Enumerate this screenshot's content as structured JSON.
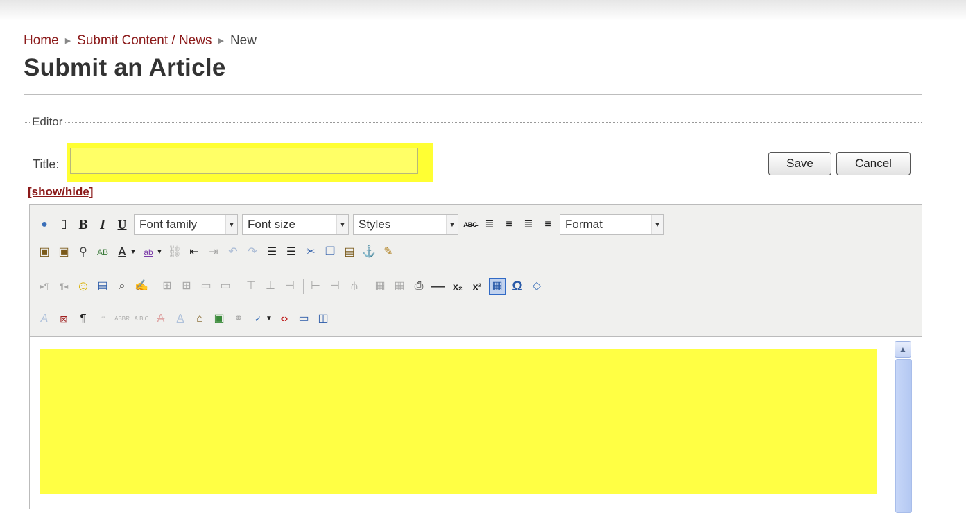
{
  "breadcrumb": {
    "items": [
      "Home",
      "Submit Content / News"
    ],
    "current": "New"
  },
  "page_title": "Submit an Article",
  "fieldset": {
    "legend": "Editor"
  },
  "form": {
    "title_label": "Title:",
    "title_value": "",
    "save_label": "Save",
    "cancel_label": "Cancel",
    "showhide_label": "[show/hide]"
  },
  "toolbar": {
    "font_family": "Font family",
    "font_size": "Font size",
    "styles": "Styles",
    "format": "Format",
    "bold": "B",
    "italic": "I",
    "underline": "U"
  },
  "colors": {
    "highlight": "#ffff33",
    "link": "#8b1a1a"
  }
}
